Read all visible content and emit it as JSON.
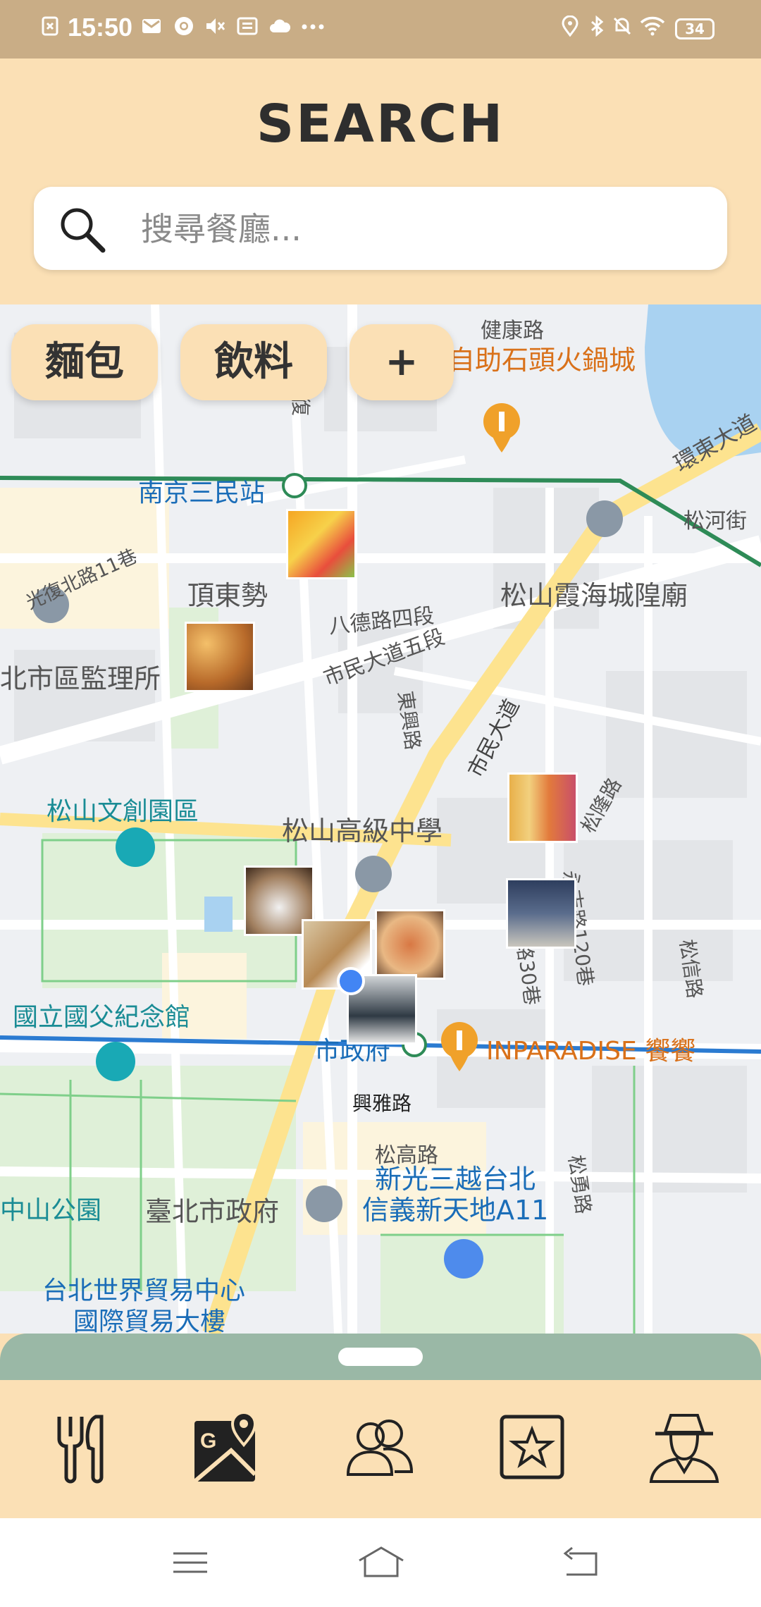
{
  "status_bar": {
    "time": "15:50",
    "left_icons": [
      "notification-icon",
      "mail-icon",
      "chrome-icon",
      "mute-icon",
      "message-icon",
      "cloud-icon",
      "more-icon"
    ],
    "right_icons": [
      "location-icon",
      "bluetooth-icon",
      "dnd-icon",
      "wifi-icon"
    ],
    "battery": "34"
  },
  "header": {
    "title": "SEARCH",
    "search_placeholder": "搜尋餐廳..."
  },
  "map": {
    "chips": [
      "麵包",
      "飲料",
      "+"
    ],
    "labels": {
      "jiankang": "健康路",
      "hotpot": "自助石頭火鍋城",
      "huandong": "環東大道",
      "nanjing": "南京三民站",
      "songhe": "松河街",
      "guangfu": "光復北路11巷",
      "dingdong": "頂東勢",
      "bade": "八德路四段",
      "shimin5": "市民大道五段",
      "jianguan": "北市區監理所",
      "temple": "松山霞海城隍廟",
      "dongxing": "東興路",
      "shiminroad": "市民大道",
      "wenchuang": "松山文創園區",
      "highschool": "松山高級中學",
      "yongji": "永吉路120巷",
      "songlong": "松隆路",
      "alley30": "路30巷",
      "songxin": "松信路",
      "sysmemorial": "國立國父紀念館",
      "cityhall_station": "市政府",
      "inparadise": "INPARADISE 饗饗",
      "xingya": "興雅路",
      "songgao": "松高路",
      "shinkong": "新光三越台北",
      "a11": "信義新天地A11",
      "songyong": "松勇路",
      "zhongshan": "中山公園",
      "cityhall": "臺北市政府",
      "wtc1": "台北世界貿易中心",
      "wtc2": "國際貿易大樓",
      "fuxing": "光復"
    }
  },
  "bottom_nav": {
    "items": [
      "restaurant-icon",
      "map-icon",
      "friends-icon",
      "favorites-icon",
      "profile-icon"
    ]
  },
  "system_nav": [
    "menu-icon",
    "home-icon",
    "back-icon"
  ],
  "colors": {
    "status_bar": "#c9ad86",
    "header_bg": "#fbe0b5",
    "sheet": "#9ab8a6",
    "user_dot": "#4285f4"
  }
}
